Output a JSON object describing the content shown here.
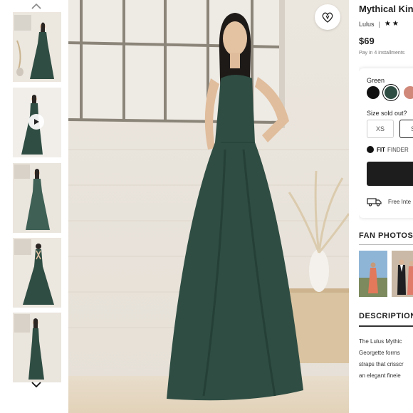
{
  "product": {
    "title": "Mythical Kind",
    "brand": "Lulus",
    "separator": "|",
    "stars": "★★",
    "price": "$69",
    "installments": "Pay in 4 installments"
  },
  "selector": {
    "color_label": "Green",
    "swatches": [
      {
        "name": "black",
        "color": "#111111"
      },
      {
        "name": "green",
        "color": "#2f4d43",
        "selected": true
      },
      {
        "name": "rose",
        "color": "#d08879"
      }
    ],
    "size_label": "Size sold out?",
    "sizes": [
      "XS",
      "S"
    ],
    "fit_brand": "FIT",
    "fit_text": "FINDER",
    "shipping": "Free Inte"
  },
  "sections": {
    "fan_photos": "FAN PHOTOS",
    "description": "DESCRIPTION",
    "description_lines": [
      "The Lulus Mythic",
      "Georgette forms",
      "straps that crisscr",
      "an elegant fineie"
    ]
  },
  "icons": {
    "up": "chevron-up-icon",
    "down": "chevron-down-icon",
    "play": "play-icon",
    "favorite": "heart-icon",
    "truck": "truck-icon",
    "fit": "fit-finder-icon"
  },
  "colors": {
    "dress": "#2f4d43",
    "accent": "#1d1d1d"
  }
}
